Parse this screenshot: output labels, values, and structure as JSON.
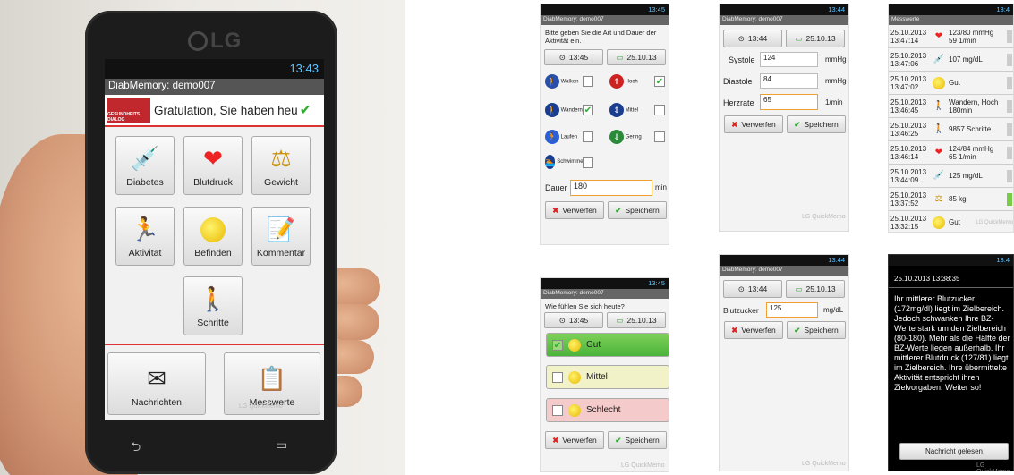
{
  "phone": {
    "brand": "LG",
    "status_time": "13:43",
    "app_title": "DiabMemory: demo007",
    "banner_logo_text": "GESUNDHEITS DIALOG",
    "banner_text": "Gratulation, Sie haben heu",
    "tiles": [
      "Diabetes",
      "Blutdruck",
      "Gewicht",
      "Aktivität",
      "Befinden",
      "Kommentar",
      "Schritte"
    ],
    "bottom_tiles": [
      "Nachrichten",
      "Messwerte"
    ],
    "watermark": "LG QuickMemo"
  },
  "activity": {
    "status_time": "13:45",
    "title": "DiabMemory: demo007",
    "prompt": "Bitte geben Sie die Art und Dauer der Aktivität ein.",
    "time": "13:45",
    "date": "25.10.13",
    "types": [
      "Walken",
      "Wandern",
      "Laufen",
      "Schwimmen"
    ],
    "intensity": [
      "Hoch",
      "Mittel",
      "Gering"
    ],
    "duration_label": "Dauer",
    "duration_value": "180",
    "duration_unit": "min",
    "discard": "Verwerfen",
    "save": "Speichern"
  },
  "bp": {
    "status_time": "13:44",
    "title": "DiabMemory: demo007",
    "time": "13:44",
    "date": "25.10.13",
    "systole_label": "Systole",
    "systole_value": "124",
    "diastole_label": "Diastole",
    "diastole_value": "84",
    "pulse_label": "Herzrate",
    "pulse_value": "65",
    "unit_mmhg": "mmHg",
    "unit_pulse": "1/min",
    "discard": "Verwerfen",
    "save": "Speichern",
    "watermark": "LG QuickMemo"
  },
  "values": {
    "title": "Messwerte",
    "status_time": "13:4",
    "rows": [
      {
        "date": "25.10.2013",
        "time": "13:47:14",
        "value": "123/80 mmHg",
        "value2": "59 1/min",
        "icon": "heart-icon"
      },
      {
        "date": "25.10.2013",
        "time": "13:47:06",
        "value": "107 mg/dL",
        "value2": "",
        "icon": "syringe-icon"
      },
      {
        "date": "25.10.2013",
        "time": "13:47:02",
        "value": "Gut",
        "value2": "",
        "icon": "smiley-icon"
      },
      {
        "date": "25.10.2013",
        "time": "13:46:45",
        "value": "Wandern, Hoch",
        "value2": "180min",
        "icon": "hiker-icon"
      },
      {
        "date": "25.10.2013",
        "time": "13:46:25",
        "value": "9857 Schritte",
        "value2": "",
        "icon": "steps-icon"
      },
      {
        "date": "25.10.2013",
        "time": "13:46:14",
        "value": "124/84 mmHg",
        "value2": "65 1/min",
        "icon": "heart-icon"
      },
      {
        "date": "25.10.2013",
        "time": "13:44:09",
        "value": "125 mg/dL",
        "value2": "",
        "icon": "syringe-icon"
      },
      {
        "date": "25.10.2013",
        "time": "13:37:52",
        "value": "85 kg",
        "value2": "",
        "icon": "weight-icon"
      },
      {
        "date": "25.10.2013",
        "time": "13:32:15",
        "value": "Gut",
        "value2": "",
        "icon": "smiley-icon"
      }
    ],
    "watermark": "LG QuickMemo"
  },
  "mood": {
    "status_time": "13:45",
    "title": "DiabMemory: demo007",
    "prompt": "Wie fühlen Sie sich heute?",
    "time": "13:45",
    "date": "25.10.13",
    "options": [
      "Gut",
      "Mittel",
      "Schlecht"
    ],
    "discard": "Verwerfen",
    "save": "Speichern",
    "watermark": "LG QuickMemo"
  },
  "bz": {
    "status_time": "13:44",
    "title": "DiabMemory: demo007",
    "time": "13:44",
    "date": "25.10.13",
    "label": "Blutzucker",
    "value": "125",
    "unit": "mg/dL",
    "discard": "Verwerfen",
    "save": "Speichern",
    "watermark": "LG QuickMemo"
  },
  "message": {
    "status_time": "13:4",
    "timestamp": "25.10.2013 13:38:35",
    "body": "Ihr mittlerer Blutzucker (172mg/dl) liegt im Zielbereich. Jedoch schwanken Ihre BZ-Werte stark um den Zielbereich (80-180). Mehr als die Hälfte der BZ-Werte liegen außerhalb. Ihr mittlerer Blutdruck (127/81) liegt im Zielbereich. Ihre übermittelte Aktivität entspricht ihren Zielvorgaben. Weiter so!",
    "button": "Nachricht gelesen",
    "watermark": "LG QuickMemo"
  }
}
